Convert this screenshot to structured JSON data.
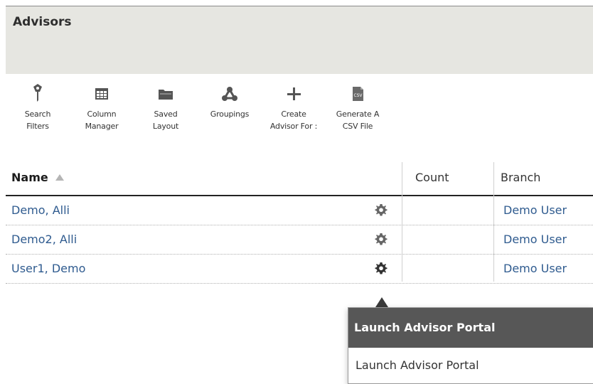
{
  "header": {
    "title": "Advisors"
  },
  "toolbar": [
    {
      "icon": "funnel-icon",
      "line1": "Search",
      "line2": "Filters"
    },
    {
      "icon": "columns-icon",
      "line1": "Column",
      "line2": "Manager"
    },
    {
      "icon": "folder-icon",
      "line1": "Saved",
      "line2": "Layout"
    },
    {
      "icon": "groupings-icon",
      "line1": "Groupings",
      "line2": ""
    },
    {
      "icon": "plus-icon",
      "line1": "Create",
      "line2": "Advisor For :"
    },
    {
      "icon": "csv-file-icon",
      "line1": "Generate A",
      "line2": "CSV File"
    }
  ],
  "grid": {
    "columns": {
      "name": "Name",
      "count": "Count",
      "branch": "Branch"
    },
    "rows": [
      {
        "name": "Demo, Alli",
        "count": "",
        "branch": "Demo User"
      },
      {
        "name": "Demo2, Alli",
        "count": "",
        "branch": "Demo User"
      },
      {
        "name": "User1, Demo",
        "count": "",
        "branch": "Demo User"
      }
    ]
  },
  "popup": {
    "header": "Launch Advisor Portal",
    "item": "Launch Advisor Portal"
  },
  "colors": {
    "link": "#2f5b8f",
    "header_bg": "#e6e6e1",
    "popup_header": "#575757"
  }
}
